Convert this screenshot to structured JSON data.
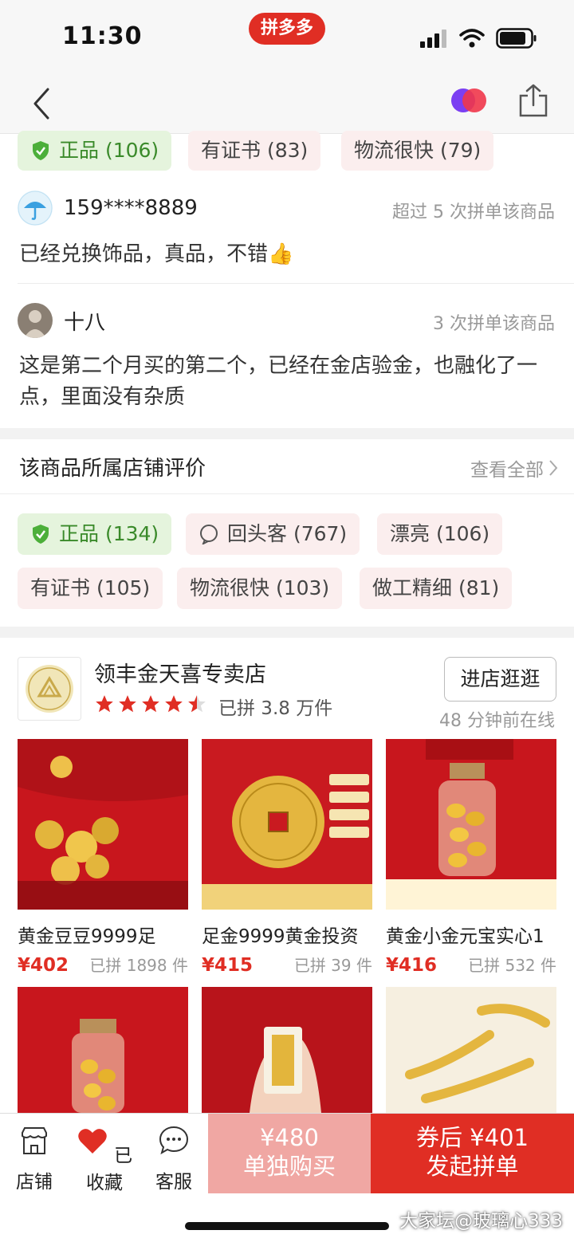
{
  "status_bar": {
    "time": "11:30",
    "app_label": "拼多多"
  },
  "product_review_tags": [
    {
      "label": "正品 (106)",
      "positive": true
    },
    {
      "label": "有证书 (83)"
    },
    {
      "label": "物流很快 (79)"
    }
  ],
  "reviews": [
    {
      "user": "159****8889",
      "purchase_info": "超过 5 次拼单该商品",
      "text": "已经兑换饰品，真品，不错👍"
    },
    {
      "user": "十八",
      "purchase_info": "3 次拼单该商品",
      "text": "这是第二个月买的第二个，已经在金店验金，也融化了一点，里面没有杂质"
    }
  ],
  "store_reviews": {
    "title": "该商品所属店铺评价",
    "more_label": "查看全部",
    "tags": [
      {
        "label": "正品 (134)",
        "positive": true
      },
      {
        "label": "回头客 (767)"
      },
      {
        "label": "漂亮 (106)"
      },
      {
        "label": "有证书 (105)"
      },
      {
        "label": "物流很快 (103)"
      },
      {
        "label": "做工精细 (81)"
      }
    ]
  },
  "shop": {
    "name": "领丰金天喜专卖店",
    "rating": 4.5,
    "sales": "已拼 3.8 万件",
    "enter_label": "进店逛逛",
    "online_status": "48 分钟前在线"
  },
  "products": [
    {
      "title": "黄金豆豆9999足",
      "price": "¥402",
      "sold": "已拼 1898 件"
    },
    {
      "title": "足金9999黄金投资",
      "price": "¥415",
      "sold": "已拼 39 件"
    },
    {
      "title": "黄金小金元宝实心1",
      "price": "¥416",
      "sold": "已拼 532 件"
    },
    {
      "title": "",
      "price": "",
      "sold": ""
    },
    {
      "title": "",
      "price": "",
      "sold": ""
    },
    {
      "title": "",
      "price": "",
      "sold": ""
    }
  ],
  "bottom_bar": {
    "store_label": "店铺",
    "favorite_label": "已收藏",
    "service_label": "客服",
    "buy_alone_price": "¥480",
    "buy_alone_label": "单独购买",
    "group_price": "券后 ¥401",
    "group_label": "发起拼单"
  },
  "watermark": "大家坛@玻璃心333",
  "colors": {
    "brand_red": "#e02e24",
    "light_red": "#f0a7a3",
    "positive_green": "#3a8a2a"
  }
}
